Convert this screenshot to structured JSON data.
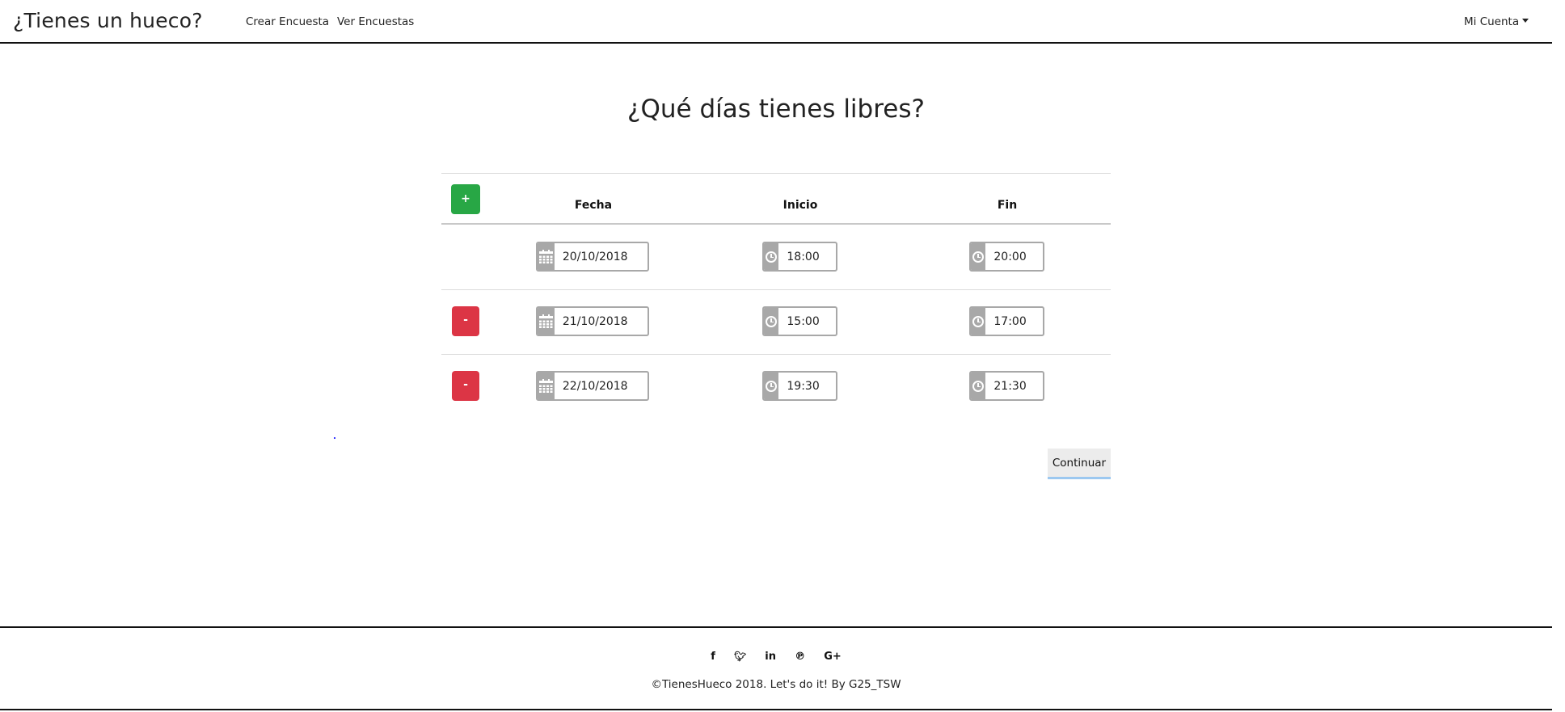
{
  "navbar": {
    "brand": "¿Tienes un hueco?",
    "links": [
      "Crear Encuesta",
      "Ver Encuestas"
    ],
    "account": "Mi Cuenta"
  },
  "page": {
    "title": "¿Qué días tienes libres?"
  },
  "table": {
    "add_button": "+",
    "remove_button": "-",
    "headers": [
      "Fecha",
      "Inicio",
      "Fin"
    ],
    "rows": [
      {
        "fecha": "20/10/2018",
        "inicio": "18:00",
        "fin": "20:00",
        "removable": false
      },
      {
        "fecha": "21/10/2018",
        "inicio": "15:00",
        "fin": "17:00",
        "removable": true
      },
      {
        "fecha": "22/10/2018",
        "inicio": "19:30",
        "fin": "21:30",
        "removable": true
      }
    ],
    "icons": {
      "date": "calendar-icon",
      "time": "clock-icon"
    }
  },
  "actions": {
    "continue": "Continuar"
  },
  "footer": {
    "social": [
      {
        "icon": "facebook-icon",
        "glyph": "f"
      },
      {
        "icon": "twitter-icon",
        "glyph": "🐦"
      },
      {
        "icon": "linkedin-icon",
        "glyph": "in"
      },
      {
        "icon": "pinterest-icon",
        "glyph": "℗"
      },
      {
        "icon": "google-plus-icon",
        "glyph": "G+"
      }
    ],
    "copyright": "©TienesHueco 2018. Let's do it! By G25_TSW"
  },
  "colors": {
    "add": "#28a745",
    "remove": "#dc3545",
    "addon": "#a8a8a8",
    "continue_underline": "#9cc8f0"
  }
}
